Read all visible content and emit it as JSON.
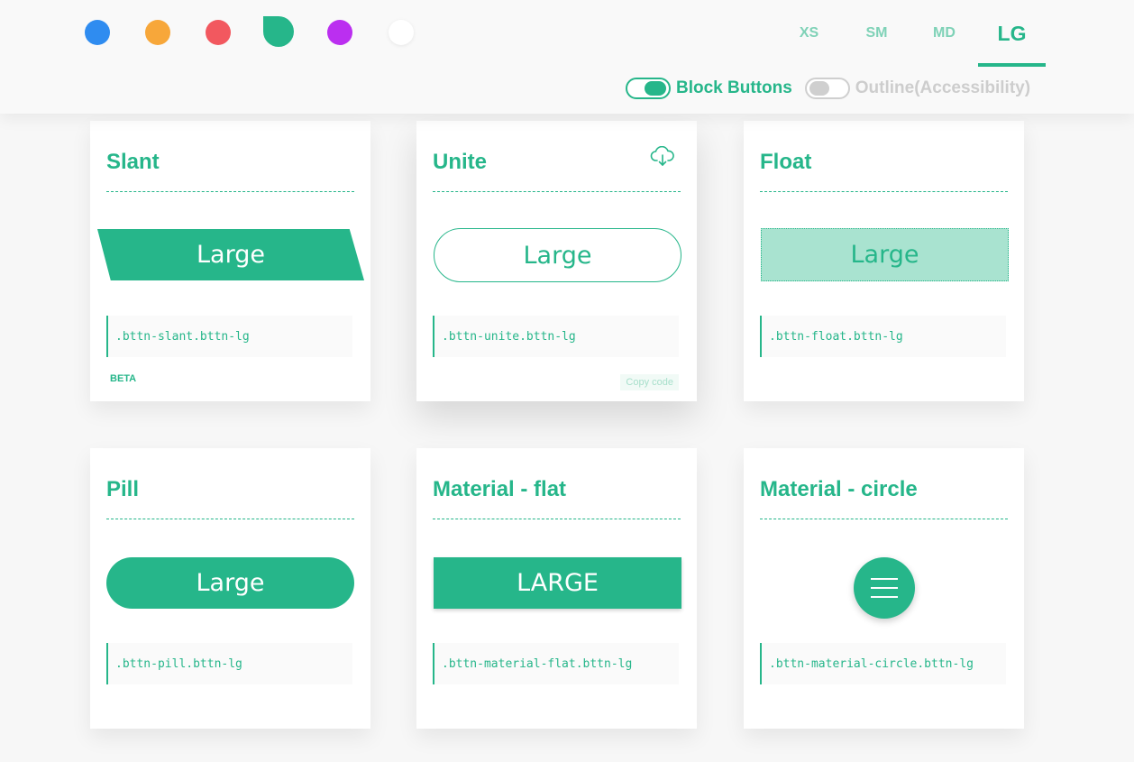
{
  "theme": {
    "accent": "#26b68a",
    "color_swatches": [
      {
        "name": "blue",
        "hex": "#2f8cf0"
      },
      {
        "name": "orange",
        "hex": "#f7a73a"
      },
      {
        "name": "red",
        "hex": "#f2585f"
      },
      {
        "name": "green",
        "hex": "#26b68a",
        "selected": true
      },
      {
        "name": "purple",
        "hex": "#bb2ff0"
      },
      {
        "name": "white",
        "hex": "#ffffff"
      }
    ]
  },
  "size_tabs": [
    {
      "label": "XS",
      "active": false
    },
    {
      "label": "SM",
      "active": false
    },
    {
      "label": "MD",
      "active": false
    },
    {
      "label": "LG",
      "active": true
    }
  ],
  "toggles": {
    "block_buttons": {
      "label": "Block Buttons",
      "on": true
    },
    "outline": {
      "label": "Outline(Accessibility)",
      "on": false
    }
  },
  "cards": [
    {
      "title": "Slant",
      "button_label": "Large",
      "code": ".bttn-slant.bttn-lg",
      "badge": "BETA"
    },
    {
      "title": "Unite",
      "button_label": "Large",
      "code": ".bttn-unite.bttn-lg",
      "copy_label": "Copy code",
      "icon": "cloud-download-icon"
    },
    {
      "title": "Float",
      "button_label": "Large",
      "code": ".bttn-float.bttn-lg"
    },
    {
      "title": "Pill",
      "button_label": "Large",
      "code": ".bttn-pill.bttn-lg"
    },
    {
      "title": "Material - flat",
      "button_label": "LARGE",
      "code": ".bttn-material-flat.bttn-lg"
    },
    {
      "title": "Material - circle",
      "button_icon": "menu-icon",
      "code": ".bttn-material-circle.bttn-lg"
    }
  ]
}
